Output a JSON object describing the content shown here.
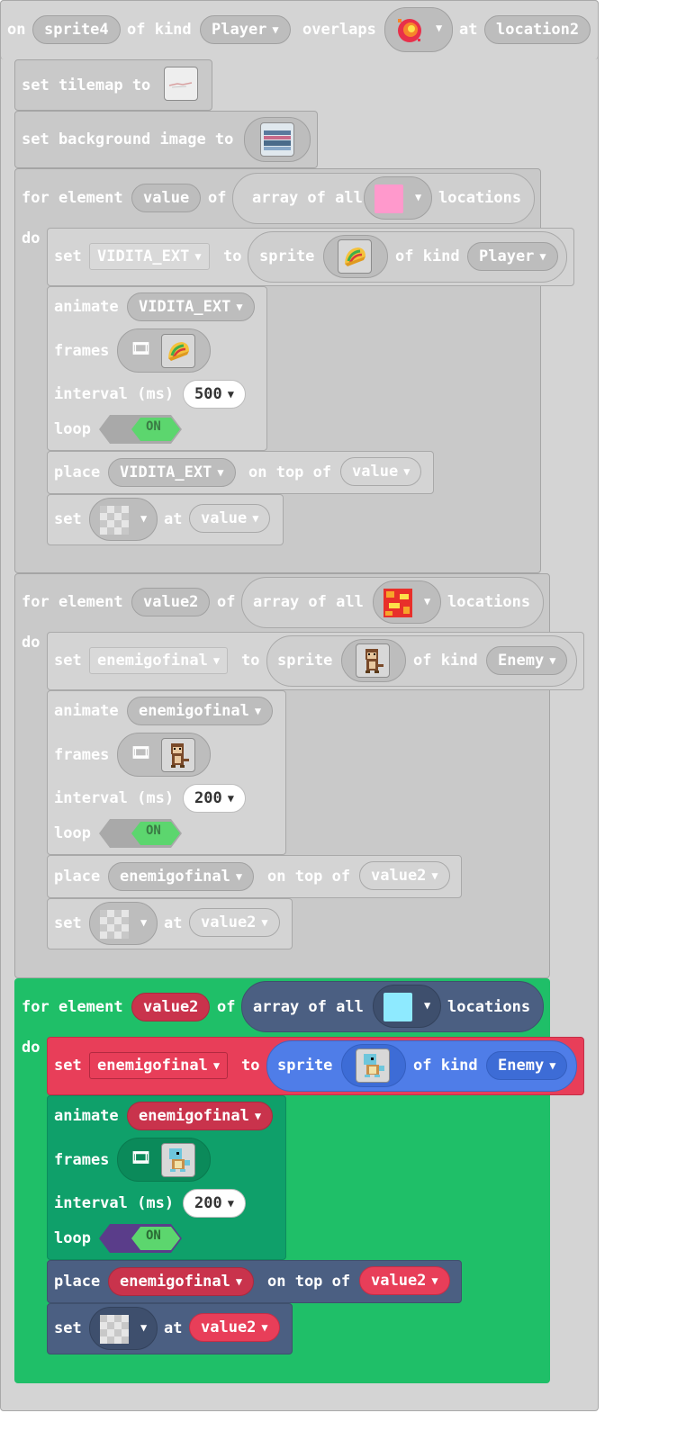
{
  "event": {
    "on": "on",
    "sprite_var": "sprite4",
    "of_kind": "of kind",
    "kind": "Player",
    "overlaps": "overlaps",
    "at": "at",
    "location_var": "location2"
  },
  "set_tilemap": {
    "label": "set tilemap to"
  },
  "set_background": {
    "label": "set background image to"
  },
  "loop1": {
    "for_element": "for element",
    "var": "value",
    "of": "of",
    "array_of_all": "array of all",
    "locations": "locations",
    "do": "do",
    "set": "set",
    "set_var": "VIDITA_EXT",
    "to": "to",
    "sprite": "sprite",
    "of_kind": "of kind",
    "kind": "Player",
    "animate": "animate",
    "animate_var": "VIDITA_EXT",
    "frames": "frames",
    "interval": "interval (ms)",
    "interval_value": "500",
    "loop": "loop",
    "on": "ON",
    "place": "place",
    "place_var": "VIDITA_EXT",
    "on_top_of": "on top of",
    "place_target": "value",
    "set2": "set",
    "at": "at",
    "at_var": "value"
  },
  "loop2": {
    "for_element": "for element",
    "var": "value2",
    "of": "of",
    "array_of_all": "array of all",
    "locations": "locations",
    "do": "do",
    "set": "set",
    "set_var": "enemigofinal",
    "to": "to",
    "sprite": "sprite",
    "of_kind": "of kind",
    "kind": "Enemy",
    "animate": "animate",
    "animate_var": "enemigofinal",
    "frames": "frames",
    "interval": "interval (ms)",
    "interval_value": "200",
    "loop": "loop",
    "on": "ON",
    "place": "place",
    "place_var": "enemigofinal",
    "on_top_of": "on top of",
    "place_target": "value2",
    "set2": "set",
    "at": "at",
    "at_var": "value2"
  },
  "loop3": {
    "for_element": "for element",
    "var": "value2",
    "of": "of",
    "array_of_all": "array of all",
    "locations": "locations",
    "do": "do",
    "set": "set",
    "set_var": "enemigofinal",
    "to": "to",
    "sprite": "sprite",
    "of_kind": "of kind",
    "kind": "Enemy",
    "animate": "animate",
    "animate_var": "enemigofinal",
    "frames": "frames",
    "interval": "interval (ms)",
    "interval_value": "200",
    "loop": "loop",
    "on": "ON",
    "place": "place",
    "place_var": "enemigofinal",
    "on_top_of": "on top of",
    "place_target": "value2",
    "set2": "set",
    "at": "at",
    "at_var": "value2"
  },
  "colors": {
    "disabled_block": "#d4d4d4",
    "loops_green": "#1fbf68",
    "sprites_navy": "#4b5f82",
    "variables_red": "#e83e59",
    "sprites_blue": "#4f7de8",
    "toggle_green": "#5cd66e",
    "animation_purple": "#5a3d8a",
    "tile_pink": "#ff99cc",
    "tile_cyan": "#8eeaff"
  },
  "icons": [
    "fireball-tile-icon",
    "tilemap-thumbnail-icon",
    "background-thumbnail-icon",
    "taco-sprite-icon",
    "monkey-sprite-icon",
    "squirtle-sprite-icon",
    "lava-tile-icon",
    "transparent-tile-icon",
    "film-frames-icon",
    "caret-down-icon"
  ]
}
